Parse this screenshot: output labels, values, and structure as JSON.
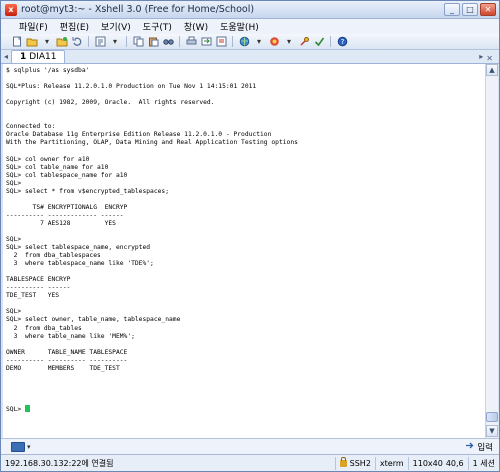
{
  "window": {
    "title": "root@myt3:~ - Xshell 3.0 (Free for Home/School)",
    "controls": {
      "minimize": "_",
      "maximize": "□",
      "close": "✕"
    }
  },
  "menu": [
    "파일(F)",
    "편집(E)",
    "보기(V)",
    "도구(T)",
    "창(W)",
    "도움말(H)"
  ],
  "toolbar": {
    "icons": [
      "new-session-icon",
      "open-folder-icon",
      "folder-dropdown-icon",
      "connect-icon",
      "reconnect-icon",
      "properties-icon",
      "copy-icon",
      "paste-icon",
      "find-icon",
      "print-icon",
      "transfer-icon",
      "script-icon",
      "globe-icon",
      "color-icon",
      "key-icon",
      "help-icon"
    ]
  },
  "tabs": [
    {
      "label": "DIA11",
      "number": "1"
    }
  ],
  "terminal": {
    "lines": [
      "$ sqlplus '/as sysdba'",
      "",
      "SQL*Plus: Release 11.2.0.1.0 Production on Tue Nov 1 14:15:01 2011",
      "",
      "Copyright (c) 1982, 2009, Oracle.  All rights reserved.",
      "",
      "",
      "Connected to:",
      "Oracle Database 11g Enterprise Edition Release 11.2.0.1.0 - Production",
      "With the Partitioning, OLAP, Data Mining and Real Application Testing options",
      "",
      "SQL> col owner for a10",
      "SQL> col table_name for a10",
      "SQL> col tablespace_name for a10",
      "SQL>",
      "SQL> select * from v$encrypted_tablespaces;",
      "",
      "       TS# ENCRYPTIONALG  ENCRYP",
      "---------- ------------- ------",
      "         7 AES128         YES",
      "",
      "SQL>",
      "SQL> select tablespace_name, encrypted",
      "  2  from dba_tablespaces",
      "  3  where tablespace_name like 'TDE%';",
      "",
      "TABLESPACE ENCRYP",
      "---------- ------",
      "TDE_TEST   YES",
      "",
      "SQL>",
      "SQL> select owner, table_name, tablespace_name",
      "  2  from dba_tables",
      "  3  where table_name like 'MEM%';",
      "",
      "OWNER      TABLE_NAME TABLESPACE",
      "---------- ---------- ----------",
      "DEMO       MEMBERS    TDE_TEST",
      "",
      "",
      "",
      "",
      "SQL> "
    ],
    "cursor_color": "#22c35a"
  },
  "compose": {
    "right_label": "입력"
  },
  "status": {
    "connection": "192.168.30.132:22에 연결됨",
    "protocol": "SSH2",
    "terminal_type": "xterm",
    "size": "110x40",
    "position": "40,6",
    "sessions": "1 세션"
  }
}
